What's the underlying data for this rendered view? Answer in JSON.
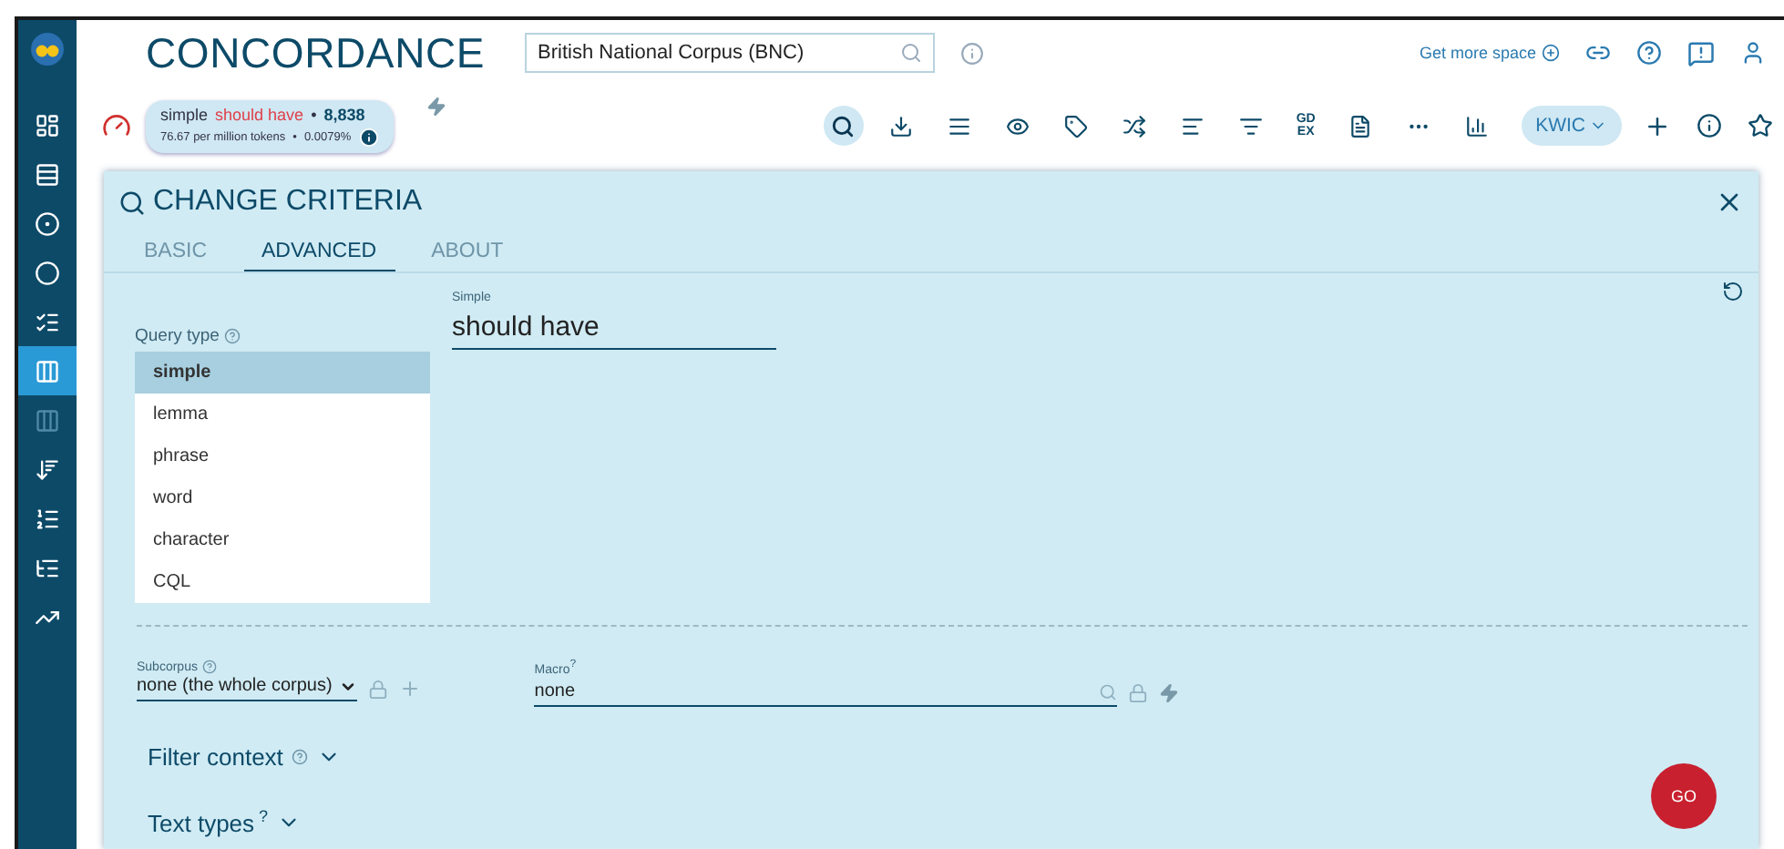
{
  "header": {
    "title": "CONCORDANCE",
    "corpus": "British National Corpus (BNC)",
    "more_space": "Get more space"
  },
  "summary": {
    "query_type": "simple",
    "query": "should have",
    "separator": "•",
    "hits": "8,838",
    "per_million": "76.67 per million tokens",
    "percent": "0.0079%"
  },
  "sidebar": {
    "items": [
      {
        "selected": false,
        "disabled": false
      },
      {
        "selected": false,
        "disabled": false
      },
      {
        "selected": false,
        "disabled": false
      },
      {
        "selected": false,
        "disabled": false
      },
      {
        "selected": false,
        "disabled": false
      },
      {
        "selected": true,
        "disabled": false
      },
      {
        "selected": false,
        "disabled": true
      },
      {
        "selected": false,
        "disabled": false
      },
      {
        "selected": false,
        "disabled": false
      },
      {
        "selected": false,
        "disabled": false
      },
      {
        "selected": false,
        "disabled": false
      }
    ]
  },
  "toolbar": {
    "items": [
      {
        "kind": "icon",
        "selected": true
      },
      {
        "kind": "icon",
        "selected": false
      },
      {
        "kind": "icon",
        "selected": false
      },
      {
        "kind": "icon",
        "selected": false
      },
      {
        "kind": "icon",
        "selected": false
      },
      {
        "kind": "icon",
        "selected": false
      },
      {
        "kind": "icon",
        "selected": false
      },
      {
        "kind": "icon",
        "selected": false
      },
      {
        "kind": "text",
        "label": "GD EX"
      },
      {
        "kind": "icon",
        "selected": false
      },
      {
        "kind": "icon",
        "selected": false
      },
      {
        "kind": "icon",
        "selected": false
      }
    ],
    "view": "KWIC"
  },
  "panel": {
    "title": "CHANGE CRITERIA",
    "tabs": [
      {
        "label": "BASIC",
        "selected": false
      },
      {
        "label": "ADVANCED",
        "selected": true
      },
      {
        "label": "ABOUT",
        "selected": false
      }
    ],
    "query_type": {
      "label": "Query type",
      "options": [
        {
          "label": "simple",
          "selected": true
        },
        {
          "label": "lemma",
          "selected": false
        },
        {
          "label": "phrase",
          "selected": false
        },
        {
          "label": "word",
          "selected": false
        },
        {
          "label": "character",
          "selected": false
        },
        {
          "label": "CQL",
          "selected": false
        }
      ]
    },
    "query": {
      "label": "Simple",
      "value": "should have"
    },
    "subcorpus": {
      "label": "Subcorpus",
      "value": "none (the whole corpus)"
    },
    "macro": {
      "label": "Macro",
      "mark": "?",
      "value": "none"
    },
    "sections": [
      {
        "label": "Filter context",
        "help_icon": true
      },
      {
        "label": "Text types",
        "help_icon": false,
        "help_mark": "?"
      }
    ],
    "go": "GO"
  }
}
